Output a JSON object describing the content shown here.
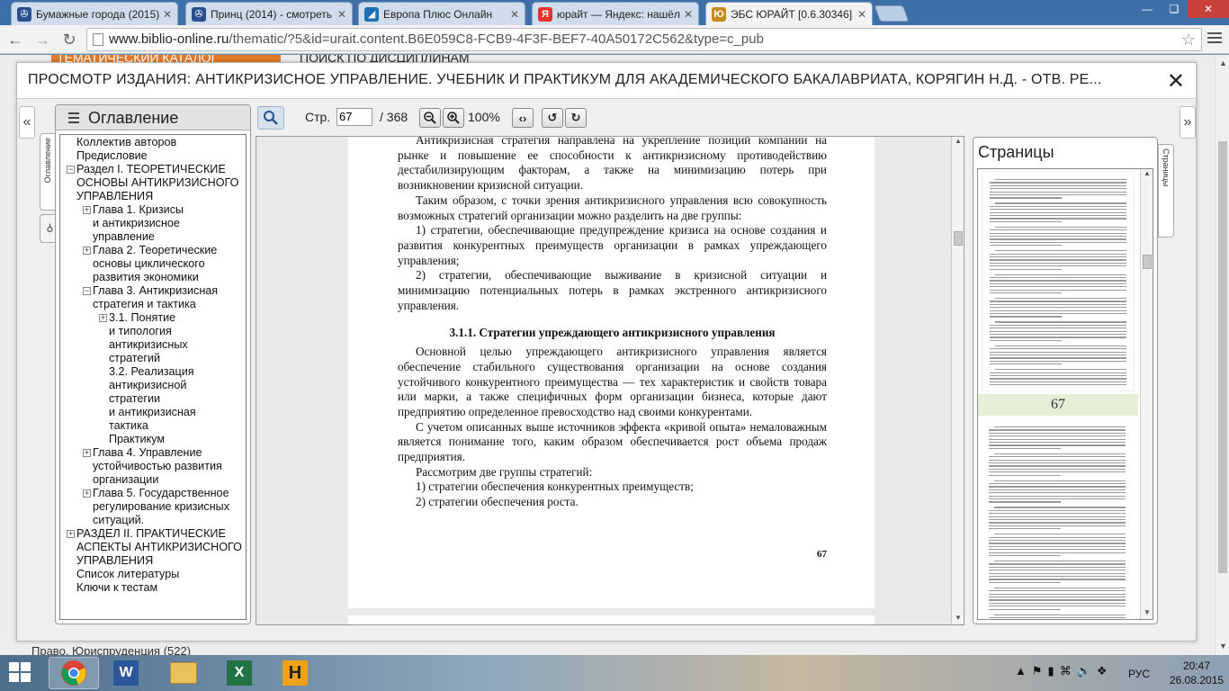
{
  "browser": {
    "tabs": [
      {
        "title": "Бумажные города (2015)",
        "favicon_color": "#2a4f8f",
        "favicon_glyph": "✇"
      },
      {
        "title": "Принц (2014) - смотреть",
        "favicon_color": "#2a4f8f",
        "favicon_glyph": "✇"
      },
      {
        "title": "Европа Плюс Онлайн",
        "favicon_color": "#1b6fb3",
        "favicon_glyph": "◢"
      },
      {
        "title": "юрайт — Яндекс: нашёлс",
        "favicon_color": "#e8322c",
        "favicon_glyph": "Я"
      },
      {
        "title": "ЭБС ЮРАЙТ [0.6.30346]",
        "favicon_color": "#c68a1a",
        "favicon_glyph": "Ю"
      }
    ],
    "url_host": "www.biblio-online.ru",
    "url_path": "/thematic/?5&id=urait.content.B6E059C8-FCB9-4F3F-BEF7-40A50172C562&type=c_pub"
  },
  "site": {
    "nav_catalog": "ТЕМАТИЧЕСКИЙ КАТАЛОГ",
    "nav_search": "ПОИСК ПО ДИСЦИПЛИНАМ",
    "footer_text": "Право. Юриспруденция (522)"
  },
  "viewer": {
    "title": "ПРОСМОТР ИЗДАНИЯ: АНТИКРИЗИСНОЕ УПРАВЛЕНИЕ. УЧЕБНИК И ПРАКТИКУМ ДЛЯ АКАДЕМИЧЕСКОГО БАКАЛАВРИАТА, КОРЯГИН Н.Д. - ОТВ. РЕ...",
    "close_glyph": "✕",
    "left_arrow": "«",
    "right_arrow": "»",
    "toc_vertical_label": "Оглавление",
    "pages_vertical_label": "Страницы",
    "toolbar": {
      "page_label": "Стр.",
      "page_value": "67",
      "page_total": "/ 368",
      "zoom": "100%"
    },
    "toc": {
      "title": "Оглавление",
      "rows": [
        {
          "indent": 0,
          "toggle": "",
          "lines": [
            "Коллектив авторов"
          ]
        },
        {
          "indent": 0,
          "toggle": "",
          "lines": [
            "Предисловие"
          ]
        },
        {
          "indent": 0,
          "toggle": "−",
          "lines": [
            "Раздел I. ТЕОРЕТИЧЕСКИЕ",
            "ОСНОВЫ АНТИКРИЗИСНОГО",
            "УПРАВЛЕНИЯ"
          ]
        },
        {
          "indent": 1,
          "toggle": "+",
          "lines": [
            "Глава 1. Кризисы",
            "и антикризисное",
            "управление"
          ]
        },
        {
          "indent": 1,
          "toggle": "+",
          "lines": [
            "Глава 2. Теоретические",
            "основы циклического",
            "развития экономики"
          ]
        },
        {
          "indent": 1,
          "toggle": "−",
          "lines": [
            "Глава 3. Антикризисная",
            "стратегия и тактика"
          ]
        },
        {
          "indent": 2,
          "toggle": "+",
          "lines": [
            "3.1. Понятие",
            "и типология",
            "антикризисных",
            "стратегий"
          ]
        },
        {
          "indent": 2,
          "toggle": "",
          "lines": [
            "3.2. Реализация",
            "антикризисной",
            "стратегии",
            "и антикризисная",
            "тактика"
          ]
        },
        {
          "indent": 2,
          "toggle": "",
          "lines": [
            "Практикум"
          ]
        },
        {
          "indent": 1,
          "toggle": "+",
          "lines": [
            "Глава 4. Управление",
            "устойчивостью развития",
            "организации"
          ]
        },
        {
          "indent": 1,
          "toggle": "+",
          "lines": [
            "Глава 5. Государственное",
            "регулирование кризисных",
            "ситуаций."
          ]
        },
        {
          "indent": 0,
          "toggle": "+",
          "lines": [
            "РАЗДЕЛ II. ПРАКТИЧЕСКИЕ",
            "АСПЕКТЫ АНТИКРИЗИСНОГО",
            "УПРАВЛЕНИЯ"
          ]
        },
        {
          "indent": 0,
          "toggle": "",
          "lines": [
            "Список литературы"
          ]
        },
        {
          "indent": 0,
          "toggle": "",
          "lines": [
            "Ключи к тестам"
          ]
        }
      ]
    },
    "document": {
      "paragraphs": [
        {
          "type": "p",
          "text": "Антикризисная стратегия направлена на укрепление позиций компании на рынке и повышение ее способности к антикризисному противодействию дестабилизирующим факторам, а также на минимизацию потерь при возникновении кризисной ситуации."
        },
        {
          "type": "p",
          "text": "Таким образом, с точки зрения антикризисного управления всю совокупность возможных стратегий организации можно разделить на две группы:"
        },
        {
          "type": "p",
          "text": "1) стратегии, обеспечивающие предупреждение кризиса на основе создания и развития конкурентных преимуществ организации в рамках упреждающего управления;"
        },
        {
          "type": "p",
          "text": "2) стратегии, обеспечивающие выживание в кризисной ситуации и минимизацию потенциальных потерь в рамках экстренного антикризисного управления."
        },
        {
          "type": "h",
          "text": "3.1.1. Стратегии упреждающего антикризисного управления"
        },
        {
          "type": "p",
          "text": "Основной целью упреждающего антикризисного управления является обеспечение стабильного существования организации на основе создания устойчивого конкурентного преимущества — тех характеристик и свойств товара или марки, а также специфичных форм организации бизнеса, которые дают предприятию определенное превосходство над своими конкурентами."
        },
        {
          "type": "p",
          "text": "С учетом описанных выше источников эффекта «кривой опыта» немаловажным является понимание того, каким образом обеспечивается рост объема продаж предприятия."
        },
        {
          "type": "p",
          "text": "Рассмотрим две группы стратегий:"
        },
        {
          "type": "p",
          "text": "1) стратегии обеспечения конкурентных преимуществ;"
        },
        {
          "type": "p",
          "text": "2) стратегии обеспечения роста."
        }
      ],
      "page_number": "67"
    },
    "pages_panel": {
      "title": "Страницы",
      "thumb_page_number": "67"
    }
  },
  "taskbar": {
    "language": "РУС",
    "time": "20:47",
    "date": "26.08.2015"
  },
  "colors": {
    "site_orange": "#e07a2a",
    "thumb_highlight": "#e4efd6",
    "taskbar_close": "#c7403a"
  }
}
